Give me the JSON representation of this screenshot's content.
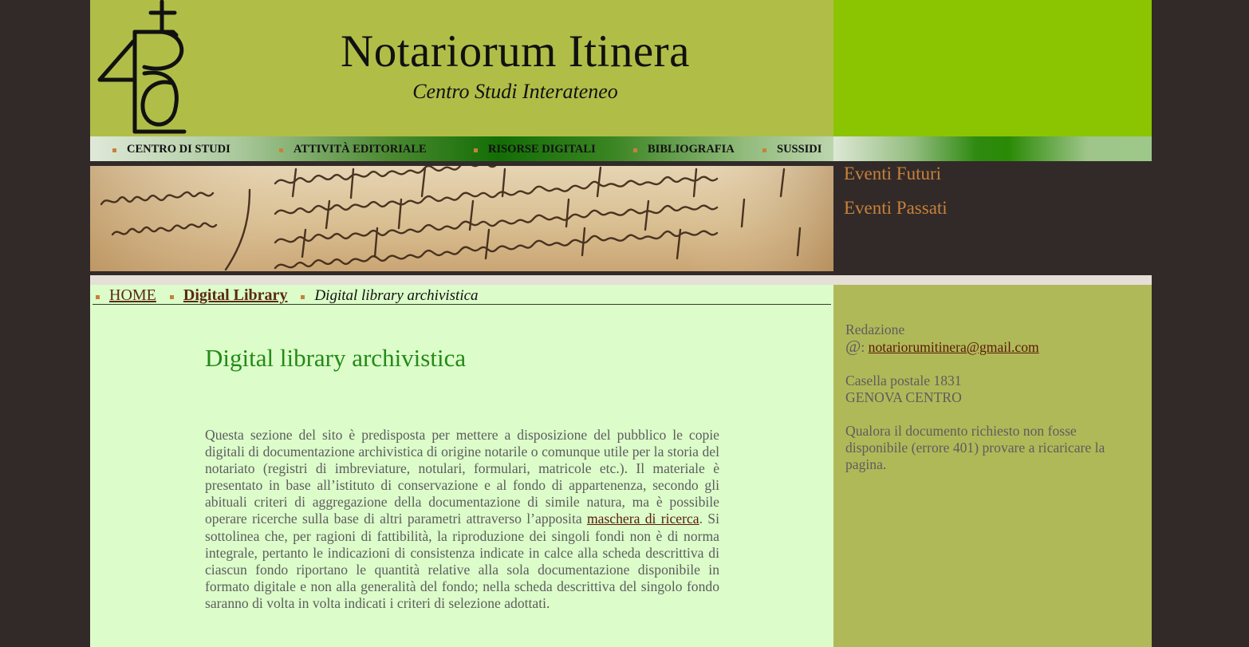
{
  "header": {
    "title": "Notariorum Itinera",
    "subtitle": "Centro Studi Interateneo",
    "logo_icon": "notarial-sign-logo-icon"
  },
  "nav": {
    "items": [
      {
        "label": "CENTRO DI STUDI"
      },
      {
        "label": "ATTIVITÀ EDITORIALE"
      },
      {
        "label": "RISORSE DIGITALI"
      },
      {
        "label": "BIBLIOGRAFIA"
      },
      {
        "label": "SUSSIDI"
      }
    ]
  },
  "banner": {
    "image_desc": "medieval-manuscript-banner"
  },
  "side_events": {
    "future": "Eventi Futuri",
    "past": "Eventi Passati"
  },
  "breadcrumb": {
    "home": "HOME",
    "section": "Digital Library",
    "current": "Digital library archivistica"
  },
  "main": {
    "title": "Digital library archivistica",
    "paragraph_before_link": "Questa sezione del sito è predisposta per mettere a disposizione del pubblico le copie digitali di documentazione archivistica di origine notarile o comunque utile per la storia del notariato (registri di imbreviature, notulari, formulari, matricole etc.). Il materiale è presentato in base all’istituto di conservazione e al fondo di appartenenza, secondo gli abituali criteri di aggregazione della documentazione di simile natura, ma è possibile operare ricerche sulla base di altri parametri attraverso l’apposita ",
    "link_text": "maschera di ricerca",
    "paragraph_after_link": ". Si sottolinea che, per ragioni di fattibilità, la riproduzione dei singoli fondi non è di norma integrale, pertanto le indicazioni di consistenza indicate in calce alla scheda descrittiva di ciascun fondo riportano le quantità relative alla sola documentazione disponibile in formato digitale e non alla generalità del fondo; nella scheda descrittiva del singolo fondo saranno di volta in volta indicati i criteri di selezione adottati."
  },
  "sidebar": {
    "redazione_label": "Redazione",
    "at_symbol": "@",
    "at_colon": ": ",
    "email": "notariorumitinera@gmail.com",
    "postal_line1": "Casella postale 1831",
    "postal_line2": "GENOVA CENTRO",
    "notice": "Qualora il documento richiesto non fosse disponibile (errore 401) provare a ricaricare la pagina."
  },
  "colors": {
    "header_olive": "#b0be48",
    "header_green": "#8bc400",
    "main_bg": "#dcfcca",
    "sidebar_bg": "#b0b958",
    "accent_orange": "#c7813c",
    "title_green": "#248a17",
    "page_bg": "#322a28"
  }
}
